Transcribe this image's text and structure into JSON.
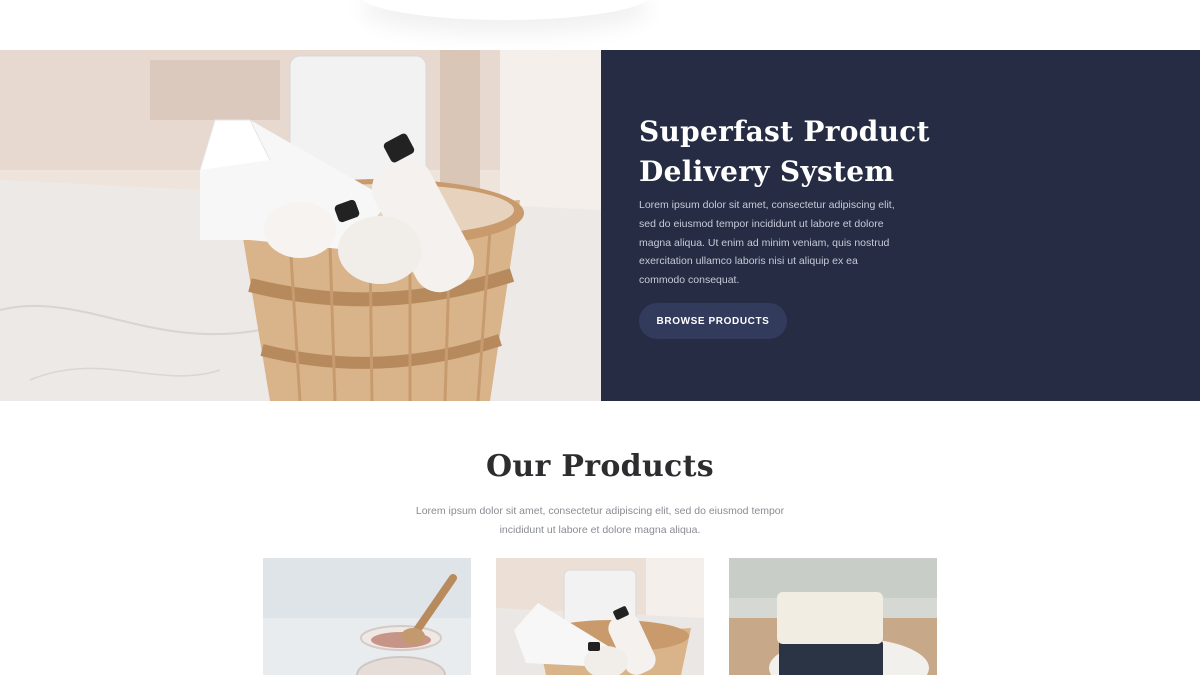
{
  "hero": {
    "title_line1": "Superfast Product",
    "title_line2": "Delivery System",
    "body_lines": [
      "Lorem ipsum dolor sit amet, consectetur adipiscing elit,",
      "sed do eiusmod tempor incididunt ut labore et dolore",
      "magna aliqua. Ut enim ad minim veniam, quis nostrud",
      "exercitation ullamco laboris nisi ut aliquip ex ea",
      "commodo consequat."
    ],
    "button_label": "BROWSE PRODUCTS",
    "image": "gift-basket-photo"
  },
  "products": {
    "title": "Our Products",
    "body_lines": [
      "Lorem ipsum dolor sit amet, consectetur adipiscing elit, sed do eiusmod tempor",
      "incididunt ut labore et dolore magna aliqua."
    ],
    "cards": [
      {
        "image": "salt-jar-wooden-spoon-photo"
      },
      {
        "image": "gift-basket-photo"
      },
      {
        "image": "soap-bars-photo"
      }
    ]
  },
  "colors": {
    "panel_bg": "#252c43",
    "button_bg": "#323b5c",
    "title_dark": "#2d2d2f",
    "muted_text": "#8a8c93"
  }
}
